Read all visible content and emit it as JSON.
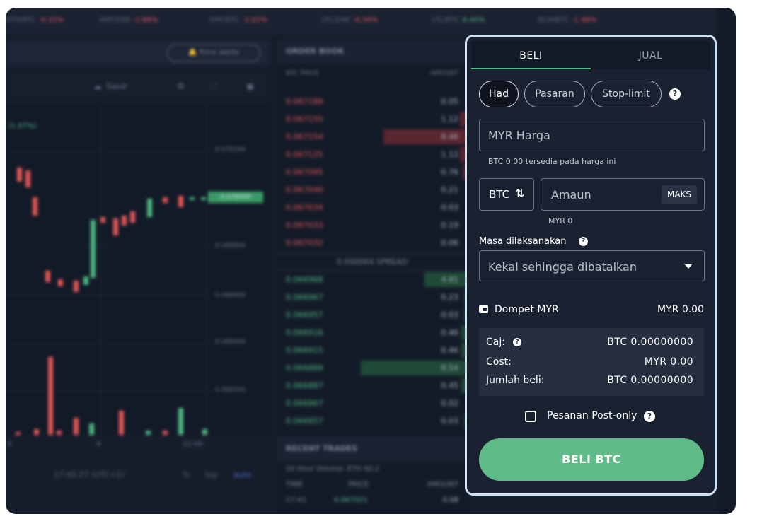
{
  "panel": {
    "tabs": [
      {
        "label": "BELI"
      },
      {
        "label": "JUAL"
      }
    ],
    "order_types": [
      {
        "label": "Had"
      },
      {
        "label": "Pasaran"
      },
      {
        "label": "Stop-limit"
      }
    ],
    "help_glyph": "?",
    "price": {
      "placeholder": "MYR Harga",
      "note": "BTC 0.00 tersedia pada harga ini"
    },
    "amount": {
      "currency": "BTC",
      "swap_glyph": "⇅",
      "placeholder": "Amaun",
      "max_label": "MAKS",
      "note": "MYR 0"
    },
    "time_in_force": {
      "label": "Masa dilaksanakan",
      "value": "Kekal sehingga dibatalkan"
    },
    "wallet": {
      "label": "Dompet MYR",
      "value": "MYR 0.00"
    },
    "summary": [
      {
        "label": "Caj:",
        "value": "BTC 0.00000000"
      },
      {
        "label": "Cost:",
        "value": "MYR 0.00"
      },
      {
        "label": "Jumlah beli:",
        "value": "BTC 0.00000000"
      }
    ],
    "post_only": {
      "label": "Pesanan Post-only",
      "checked": false
    },
    "buy_button": "BELI BTC"
  },
  "background": {
    "ticker": [
      {
        "pair": "ETH/BTC",
        "change": "-0.31%"
      },
      {
        "pair": "XRP/ZAR",
        "change": "-2.88%"
      },
      {
        "pair": "XRP/BTC",
        "change": "-2.02%"
      },
      {
        "pair": "LTC/ZAR",
        "change": "-0.34%"
      },
      {
        "pair": "LTC/BTC",
        "change": "0.40%"
      },
      {
        "pair": "BCH/BTC",
        "change": "-1.48%"
      }
    ],
    "price_alerts": "Price alerts",
    "save": "Save",
    "order_book_title": "ORDER BOOK",
    "ob_headers": [
      "BTC PRICE",
      "AMOUNT"
    ],
    "asks": [
      {
        "price": "0.067188",
        "amount": "0.05"
      },
      {
        "price": "0.067155",
        "amount": "1.12"
      },
      {
        "price": "0.067154",
        "amount": "8.46"
      },
      {
        "price": "0.067125",
        "amount": "1.12"
      },
      {
        "price": "0.067095",
        "amount": "0.76"
      },
      {
        "price": "0.067040",
        "amount": "0.21"
      },
      {
        "price": "0.067034",
        "amount": "0.03"
      },
      {
        "price": "0.067033",
        "amount": "0.19"
      },
      {
        "price": "0.067032",
        "amount": "0.06"
      }
    ],
    "spread": "0.000064 SPREAD",
    "bids": [
      {
        "price": "0.066968",
        "amount": "4.81"
      },
      {
        "price": "0.066967",
        "amount": "0.23"
      },
      {
        "price": "0.066957",
        "amount": "0.03"
      },
      {
        "price": "0.066916",
        "amount": "0.46"
      },
      {
        "price": "0.066915",
        "amount": "0.46"
      },
      {
        "price": "0.066888",
        "amount": "8.54"
      },
      {
        "price": "0.066887",
        "amount": "0.45"
      },
      {
        "price": "0.066867",
        "amount": "0.02"
      },
      {
        "price": "0.066857",
        "amount": "0.03"
      }
    ],
    "y_labels": [
      "0.070200",
      "0.068800",
      "0.068600",
      "0.068400",
      "0.068200"
    ],
    "last_price": "0.070000",
    "chart_change": "(1.07%)",
    "x_labels": [
      "3",
      "4",
      "12:00"
    ],
    "clock": "17:45:27 (UTC+2)",
    "scale_options": [
      "%",
      "log",
      "auto"
    ],
    "recent_trades_title": "RECENT TRADES",
    "volume": "24 Hour Volume: ETH 40.2",
    "rt_headers": [
      "TIME",
      "PRICE",
      "AMOUNT"
    ],
    "rt_first": {
      "time": "17:41",
      "price": "0.067021",
      "amount": "0.08"
    }
  },
  "colors": {
    "accent": "#5fbb88",
    "panel_bg": "#1a2231",
    "panel_border": "#cfe1f5",
    "ask": "#e05757",
    "bid": "#4fb883"
  }
}
